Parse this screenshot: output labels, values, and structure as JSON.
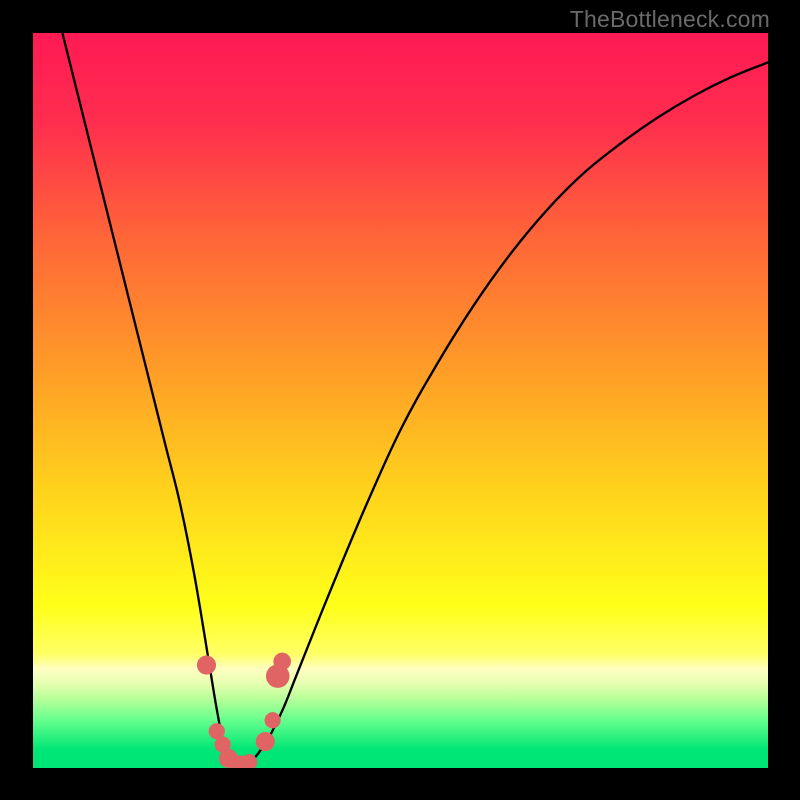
{
  "watermark": "TheBottleneck.com",
  "chart_data": {
    "type": "line",
    "title": "",
    "xlabel": "",
    "ylabel": "",
    "xlim": [
      0,
      100
    ],
    "ylim": [
      0,
      100
    ],
    "gradient_stops": [
      {
        "offset": 0.0,
        "color": "#ff1a54"
      },
      {
        "offset": 0.12,
        "color": "#ff2d4e"
      },
      {
        "offset": 0.28,
        "color": "#ff6638"
      },
      {
        "offset": 0.45,
        "color": "#ff9a28"
      },
      {
        "offset": 0.62,
        "color": "#ffd21c"
      },
      {
        "offset": 0.78,
        "color": "#ffff1a"
      },
      {
        "offset": 0.845,
        "color": "#ffff66"
      },
      {
        "offset": 0.865,
        "color": "#ffffc2"
      },
      {
        "offset": 0.885,
        "color": "#e6ffb0"
      },
      {
        "offset": 0.905,
        "color": "#b9ff9a"
      },
      {
        "offset": 0.935,
        "color": "#66ff8c"
      },
      {
        "offset": 0.975,
        "color": "#00e676"
      },
      {
        "offset": 1.0,
        "color": "#00e676"
      }
    ],
    "series": [
      {
        "name": "bottleneck-curve",
        "x": [
          4,
          6,
          8,
          10,
          12,
          14,
          16,
          18,
          20,
          22,
          24,
          25,
          26,
          27,
          28,
          29,
          30,
          32,
          34,
          36,
          40,
          45,
          50,
          55,
          60,
          65,
          70,
          75,
          80,
          85,
          90,
          95,
          100
        ],
        "y": [
          100,
          92,
          84,
          76,
          68,
          60,
          52,
          44,
          36,
          26,
          14,
          8,
          3,
          0.6,
          0,
          0.5,
          1.2,
          4,
          8,
          13,
          23,
          35,
          46,
          55,
          63,
          70,
          76,
          81,
          85,
          88.5,
          91.5,
          94,
          96
        ]
      }
    ],
    "markers": [
      {
        "x": 23.6,
        "y": 14.0,
        "r": 1.3
      },
      {
        "x": 25.0,
        "y": 5.0,
        "r": 1.1
      },
      {
        "x": 25.8,
        "y": 3.2,
        "r": 1.1
      },
      {
        "x": 26.6,
        "y": 1.3,
        "r": 1.3
      },
      {
        "x": 28.2,
        "y": 0.4,
        "r": 1.3
      },
      {
        "x": 29.4,
        "y": 0.8,
        "r": 1.1
      },
      {
        "x": 31.6,
        "y": 3.6,
        "r": 1.3
      },
      {
        "x": 32.6,
        "y": 6.5,
        "r": 1.1
      },
      {
        "x": 33.3,
        "y": 12.5,
        "r": 1.6
      },
      {
        "x": 33.9,
        "y": 14.5,
        "r": 1.2
      }
    ],
    "marker_color": "#e06464"
  }
}
